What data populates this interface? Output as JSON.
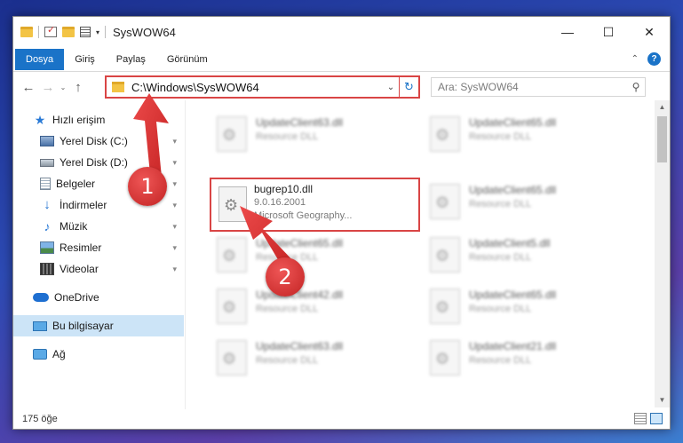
{
  "window": {
    "title": "SysWOW64",
    "minimize": "—",
    "maximize": "☐",
    "close": "✕"
  },
  "ribbon": {
    "tabs": [
      "Dosya",
      "Giriş",
      "Paylaş",
      "Görünüm"
    ],
    "collapse_glyph": "⌃",
    "help_glyph": "?"
  },
  "nav": {
    "back": "←",
    "forward": "→",
    "recent": "⌄",
    "up": "↑"
  },
  "address": {
    "path": "C:\\Windows\\SysWOW64",
    "chevron": "⌄",
    "refresh": "↻"
  },
  "search": {
    "placeholder": "Ara: SysWOW64",
    "glyph": "⚲"
  },
  "sidebar": {
    "items": [
      {
        "label": "Hızlı erişim",
        "icon": "star-icon",
        "level": 0,
        "pinned": false
      },
      {
        "label": "Yerel Disk (C:)",
        "icon": "drive-c-icon",
        "level": 1,
        "pinned": true
      },
      {
        "label": "Yerel Disk (D:)",
        "icon": "drive-icon",
        "level": 1,
        "pinned": true
      },
      {
        "label": "Belgeler",
        "icon": "documents-icon",
        "level": 1,
        "pinned": true
      },
      {
        "label": "İndirmeler",
        "icon": "downloads-icon",
        "level": 1,
        "pinned": true
      },
      {
        "label": "Müzik",
        "icon": "music-icon",
        "level": 1,
        "pinned": true
      },
      {
        "label": "Resimler",
        "icon": "pictures-icon",
        "level": 1,
        "pinned": true
      },
      {
        "label": "Videolar",
        "icon": "videos-icon",
        "level": 1,
        "pinned": true
      },
      {
        "label": "OneDrive",
        "icon": "onedrive-icon",
        "level": 0,
        "pinned": false
      },
      {
        "label": "Bu bilgisayar",
        "icon": "this-pc-icon",
        "level": 0,
        "pinned": false,
        "selected": true
      },
      {
        "label": "Ağ",
        "icon": "network-icon",
        "level": 0,
        "pinned": false
      }
    ],
    "pin_glyph": "📌"
  },
  "files": [
    {
      "name": "UpdateClient63.dll",
      "desc": "Resource DLL"
    },
    {
      "name": "UpdateClient65.dll",
      "desc": "Resource DLL"
    },
    {
      "name": "bugrep10.dll",
      "version": "9.0.16.2001",
      "company": "Microsoft Geography...",
      "focused": true
    },
    {
      "name": "UpdateClient65.dll",
      "desc": "Resource DLL"
    },
    {
      "name": "UpdateClient65.dll",
      "desc": "Resource DLL"
    },
    {
      "name": "UpdateClient5.dll",
      "desc": "Resource DLL"
    },
    {
      "name": "UpdateClient42.dll",
      "desc": "Resource DLL"
    },
    {
      "name": "UpdateClient65.dll",
      "desc": "Resource DLL"
    },
    {
      "name": "UpdateClient63.dll",
      "desc": "Resource DLL"
    },
    {
      "name": "UpdateClient21.dll",
      "desc": "Resource DLL"
    }
  ],
  "status": {
    "count": "175 öğe"
  },
  "callouts": {
    "first": "1",
    "second": "2"
  },
  "colors": {
    "accent": "#1a73c8",
    "callout": "#d94545",
    "selection": "#cce4f7"
  }
}
